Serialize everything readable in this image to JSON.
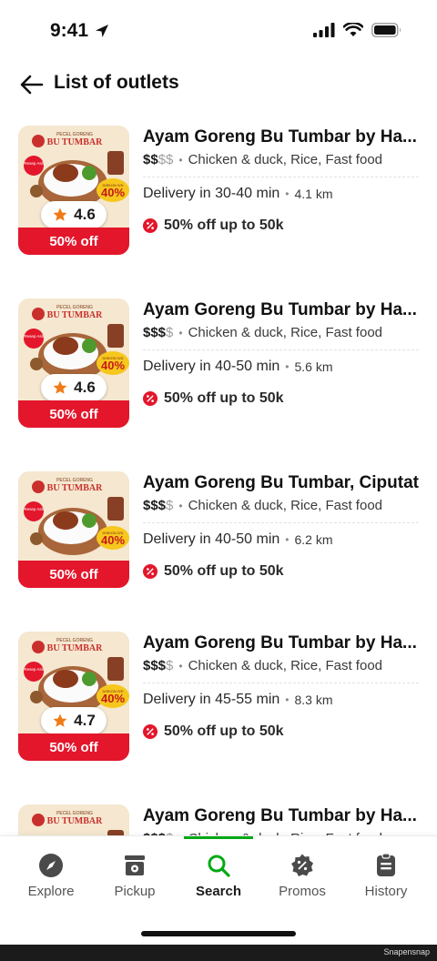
{
  "status_bar": {
    "time": "9:41"
  },
  "header": {
    "title": "List of outlets"
  },
  "outlets": [
    {
      "name": "Ayam Goreng Bu Tumbar by Ha...",
      "price_on": "$$",
      "price_off": "$$",
      "cuisines": "Chicken & duck, Rice, Fast food",
      "delivery": "Delivery in 30-40 min",
      "distance": "4.1 km",
      "offer": "50% off up to 50k",
      "rating": "4.6",
      "badge": "50% off"
    },
    {
      "name": "Ayam Goreng Bu Tumbar by Ha...",
      "price_on": "$$$",
      "price_off": "$",
      "cuisines": "Chicken & duck, Rice, Fast food",
      "delivery": "Delivery in 40-50 min",
      "distance": "5.6 km",
      "offer": "50% off up to 50k",
      "rating": "4.6",
      "badge": "50% off"
    },
    {
      "name": "Ayam Goreng Bu Tumbar, Ciputat",
      "price_on": "$$$",
      "price_off": "$",
      "cuisines": "Chicken & duck, Rice, Fast food",
      "delivery": "Delivery in 40-50 min",
      "distance": "6.2 km",
      "offer": "50% off up to 50k",
      "rating": "",
      "badge": "50% off"
    },
    {
      "name": "Ayam Goreng Bu Tumbar by Ha...",
      "price_on": "$$$",
      "price_off": "$",
      "cuisines": "Chicken & duck, Rice, Fast food",
      "delivery": "Delivery in 45-55 min",
      "distance": "8.3 km",
      "offer": "50% off up to 50k",
      "rating": "4.7",
      "badge": "50% off"
    },
    {
      "name": "Ayam Goreng Bu Tumbar by Ha...",
      "price_on": "$$$",
      "price_off": "$",
      "cuisines": "Chicken & duck, Rice, Fast food",
      "delivery": "",
      "distance": "",
      "offer": "",
      "rating": "",
      "badge": ""
    }
  ],
  "thumb_art": {
    "brand_top": "PECEL GORENG",
    "brand_main": "BU TUMBAR",
    "corner": "Resep Asli",
    "discount": "40%",
    "discount_label": "DISKON S/D"
  },
  "nav": [
    {
      "label": "Explore",
      "icon": "compass-icon"
    },
    {
      "label": "Pickup",
      "icon": "store-icon"
    },
    {
      "label": "Search",
      "icon": "search-icon",
      "active": true
    },
    {
      "label": "Promos",
      "icon": "promo-icon"
    },
    {
      "label": "History",
      "icon": "clipboard-icon"
    }
  ],
  "watermark": "Snapensnap",
  "colors": {
    "accent": "#00aa13",
    "promo_red": "#e3162b",
    "rating_star": "#f07b16"
  }
}
